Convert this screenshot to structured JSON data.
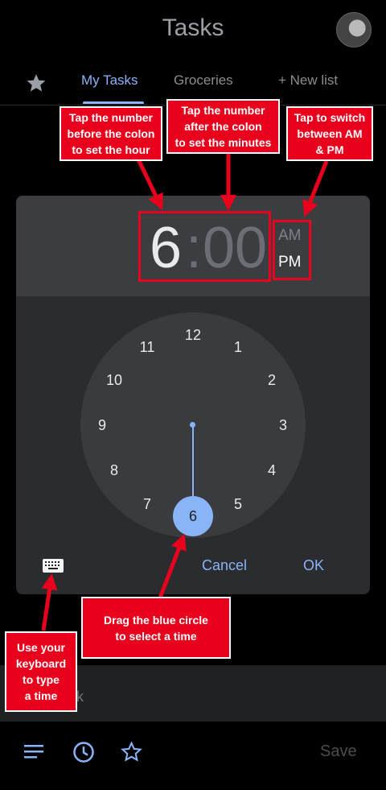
{
  "app": {
    "title": "Tasks"
  },
  "tabs": [
    {
      "label": "My Tasks"
    },
    {
      "label": "Groceries"
    },
    {
      "label": "+ New list"
    }
  ],
  "time_picker": {
    "hour": "6",
    "colon": ":",
    "minutes": "00",
    "am_label": "AM",
    "pm_label": "PM",
    "selected_period": "PM",
    "dial_numbers": [
      "12",
      "1",
      "2",
      "3",
      "4",
      "5",
      "6",
      "7",
      "8",
      "9",
      "10",
      "11"
    ],
    "selected_number": "6",
    "cancel_label": "Cancel",
    "ok_label": "OK"
  },
  "task_input": {
    "placeholder_visible": "sk"
  },
  "bottom_bar": {
    "save_label": "Save"
  },
  "annotations": {
    "hour_tip": "Tap the number\nbefore the colon\nto set the hour",
    "minute_tip": "Tap the number\nafter the colon\nto set the minutes",
    "ampm_tip": "Tap to switch\nbetween AM\n& PM",
    "drag_tip": "Drag the blue circle\nto select a time",
    "keyboard_tip": "Use your\nkeyboard\nto type\na time"
  },
  "colors": {
    "accent": "#8ab4f8",
    "annotation": "#e8001c",
    "background": "#000000"
  }
}
